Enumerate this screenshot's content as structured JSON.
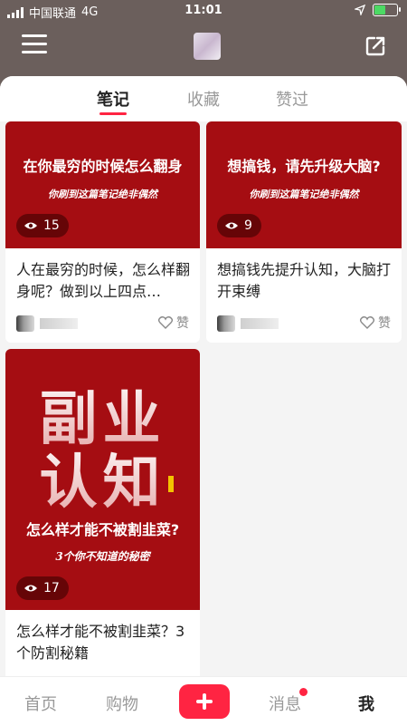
{
  "status": {
    "carrier": "中国联通",
    "network": "4G",
    "time": "11:01"
  },
  "tabs": [
    {
      "label": "笔记",
      "active": true
    },
    {
      "label": "收藏",
      "active": false
    },
    {
      "label": "赞过",
      "active": false
    }
  ],
  "notes": [
    {
      "cover_headline": "在你最穷的时候怎么翻身",
      "cover_sub": "你刷到这篇笔记绝非偶然",
      "views": "15",
      "title": "人在最穷的时候，怎么样翻身呢？做到以上四点…",
      "like_label": "赞"
    },
    {
      "cover_headline": "想搞钱，请先升级大脑?",
      "cover_sub": "你刷到这篇笔记绝非偶然",
      "views": "9",
      "title": "想搞钱先提升认知，大脑打开束缚",
      "like_label": "赞"
    },
    {
      "cover_big_line1": "副业",
      "cover_big_line2": "认知",
      "cover_headline": "怎么样才能不被割韭菜?",
      "cover_sub": "3个你不知道的秘密",
      "views": "17",
      "title": "怎么样才能不被割韭菜？3个防割秘籍"
    }
  ],
  "bottom_nav": [
    {
      "label": "首页"
    },
    {
      "label": "购物"
    },
    {
      "label": "消息",
      "has_badge": true
    },
    {
      "label": "我",
      "active": true
    }
  ],
  "colors": {
    "accent": "#ff2442",
    "cover_red": "#a50d12",
    "top_bg": "#6b5f5c"
  }
}
